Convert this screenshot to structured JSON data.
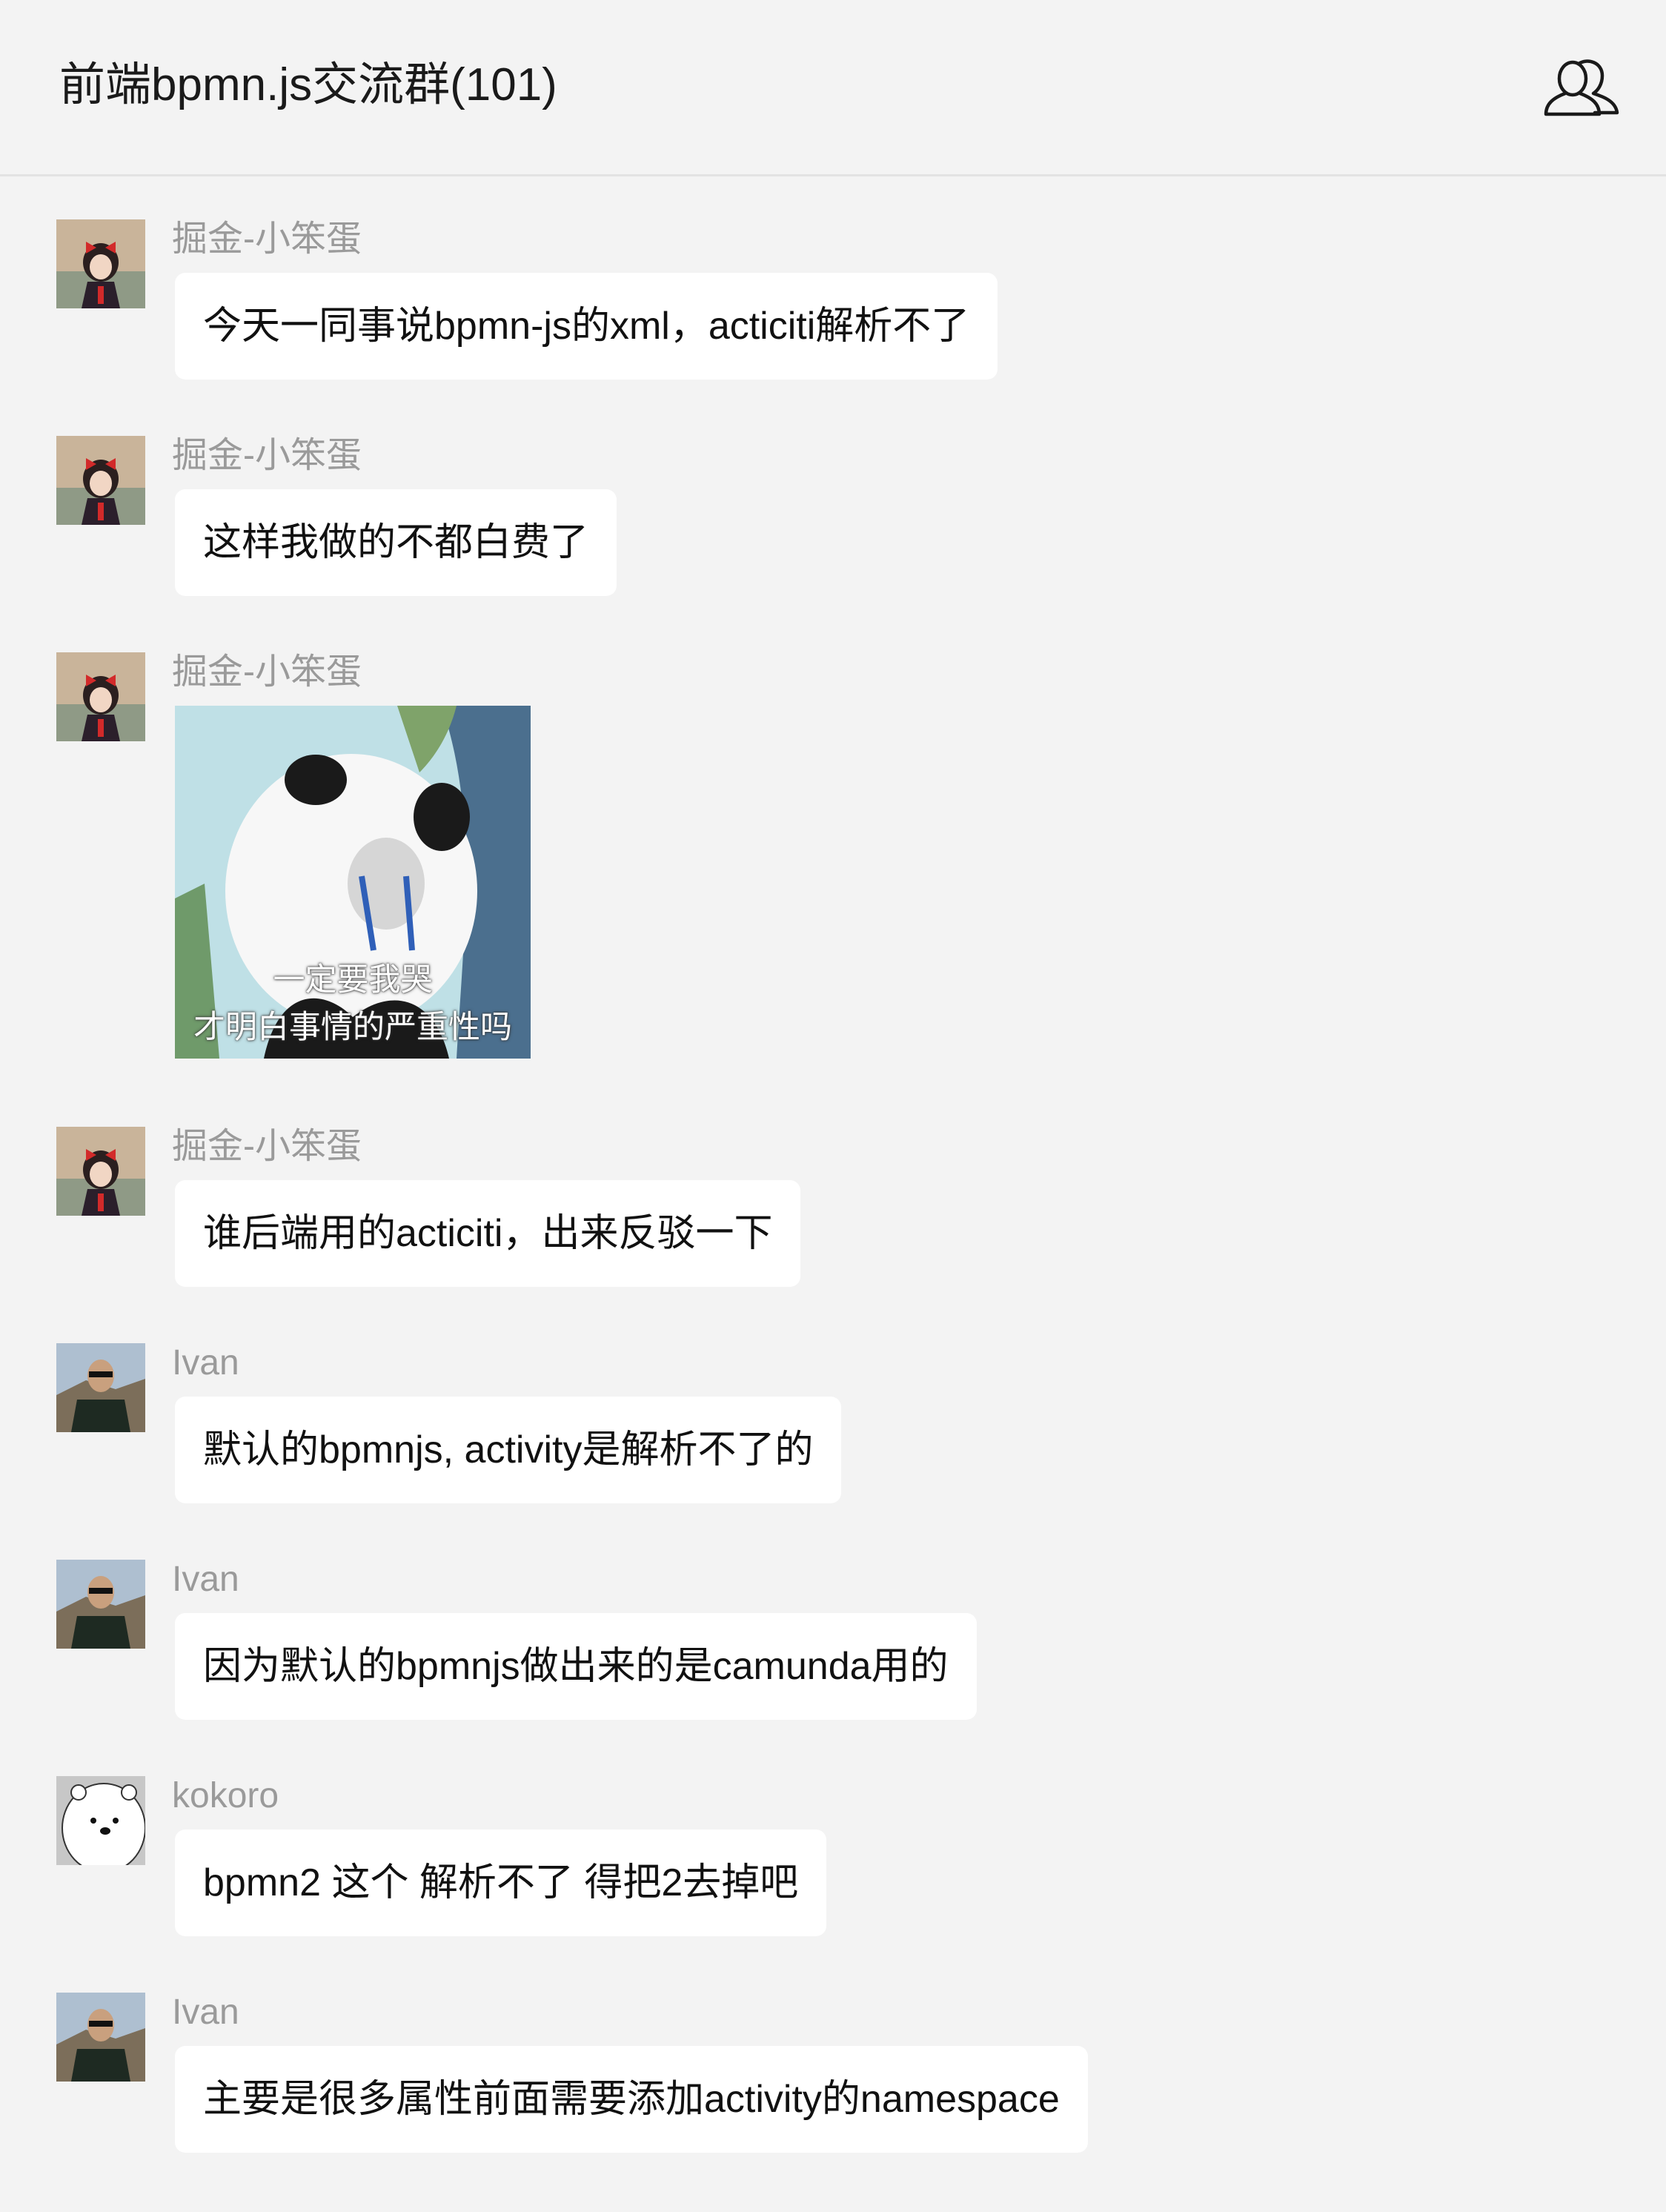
{
  "header": {
    "title": "前端bpmn.js交流群(101)",
    "members_icon": "group-members-icon"
  },
  "messages": [
    {
      "sender": "掘金-小笨蛋",
      "avatar": "girl-avatar",
      "type": "text",
      "text": "今天一同事说bpmn-js的xml，acticiti解析不了"
    },
    {
      "sender": "掘金-小笨蛋",
      "avatar": "girl-avatar",
      "type": "text",
      "text": "这样我做的不都白费了"
    },
    {
      "sender": "掘金-小笨蛋",
      "avatar": "girl-avatar",
      "type": "sticker",
      "caption_line1": "一定要我哭",
      "caption_line2": "才明白事情的严重性吗"
    },
    {
      "sender": "掘金-小笨蛋",
      "avatar": "girl-avatar",
      "type": "text",
      "text": "谁后端用的acticiti，出来反驳一下"
    },
    {
      "sender": "Ivan",
      "avatar": "man-avatar",
      "type": "text",
      "text": "默认的bpmnjs, activity是解析不了的"
    },
    {
      "sender": "Ivan",
      "avatar": "man-avatar",
      "type": "text",
      "text": "因为默认的bpmnjs做出来的是camunda用的"
    },
    {
      "sender": "kokoro",
      "avatar": "polar-bear-avatar",
      "type": "text",
      "text": "bpmn2 这个 解析不了 得把2去掉吧"
    },
    {
      "sender": "Ivan",
      "avatar": "man-avatar",
      "type": "text",
      "text": "主要是很多属性前面需要添加activity的namespace"
    }
  ],
  "colors": {
    "background": "#f3f3f3",
    "bubble": "#ffffff",
    "sender_name": "#9a9a9a",
    "text": "#111111",
    "divider": "#e2e2e2"
  }
}
